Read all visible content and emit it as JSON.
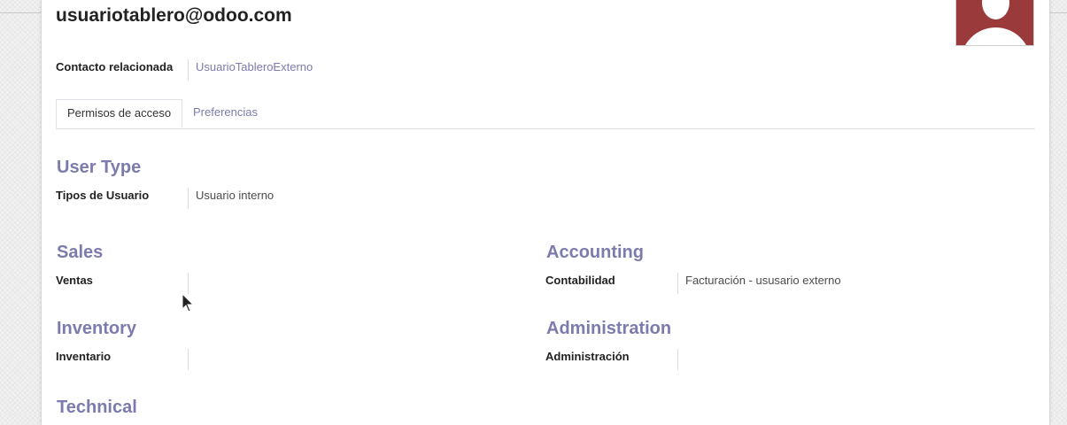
{
  "user": {
    "email": "usuariotablero@odoo.com"
  },
  "related_contact": {
    "label": "Contacto relacionada",
    "value": "UsuarioTableroExterno"
  },
  "tabs": [
    {
      "label": "Permisos de acceso",
      "active": true
    },
    {
      "label": "Preferencias",
      "active": false
    }
  ],
  "sections": {
    "user_type": {
      "title": "User Type",
      "field_label": "Tipos de Usuario",
      "field_value": "Usuario interno"
    },
    "sales": {
      "title": "Sales",
      "field_label": "Ventas",
      "field_value": ""
    },
    "accounting": {
      "title": "Accounting",
      "field_label": "Contabilidad",
      "field_value": "Facturación - ususario externo"
    },
    "inventory": {
      "title": "Inventory",
      "field_label": "Inventario",
      "field_value": ""
    },
    "administration": {
      "title": "Administration",
      "field_label": "Administración",
      "field_value": ""
    },
    "technical": {
      "title": "Technical"
    }
  },
  "colors": {
    "accent": "#7c7bad",
    "avatar": "#9b3a3a"
  }
}
